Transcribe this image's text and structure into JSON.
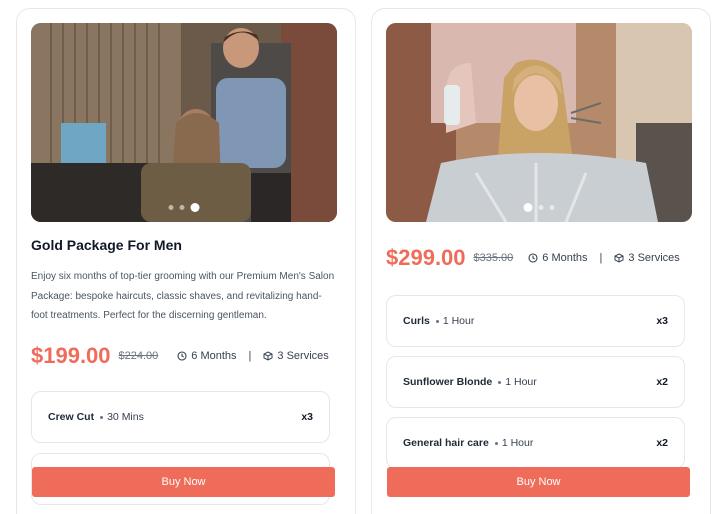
{
  "cards": [
    {
      "title": "Gold Package For Men",
      "description": "Enjoy six months of top-tier grooming with our Premium Men's Salon Package: bespoke haircuts, classic shaves, and revitalizing hand-foot treatments. Perfect for the discerning gentleman.",
      "price": "$199.00",
      "old_price": "$224.00",
      "duration": "6 Months",
      "services_count": "3 Services",
      "separator": "|",
      "carousel_active": 3,
      "services": [
        {
          "name": "Crew Cut",
          "duration": "30 Mins",
          "qty": "x3"
        }
      ],
      "buy_label": "Buy Now"
    },
    {
      "price": "$299.00",
      "old_price": "$335.00",
      "duration": "6 Months",
      "services_count": "3 Services",
      "separator": "|",
      "carousel_active": 1,
      "services": [
        {
          "name": "Curls",
          "duration": "1 Hour",
          "qty": "x3"
        },
        {
          "name": "Sunflower Blonde",
          "duration": "1 Hour",
          "qty": "x2"
        },
        {
          "name": "General hair care",
          "duration": "1 Hour",
          "qty": "x2"
        }
      ],
      "buy_label": "Buy Now"
    }
  ],
  "icons": {
    "duration": "clock-icon",
    "services": "box-icon"
  },
  "colors": {
    "accent": "#ef6c5a",
    "border": "#e5e7eb"
  }
}
